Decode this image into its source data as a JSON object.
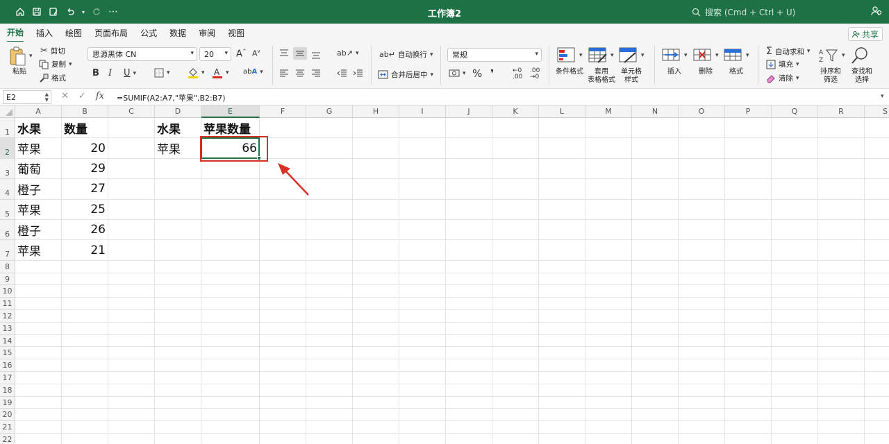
{
  "window": {
    "title": "工作簿2",
    "search_placeholder": "搜索 (Cmd + Ctrl + U)"
  },
  "tabs": [
    "开始",
    "插入",
    "绘图",
    "页面布局",
    "公式",
    "数据",
    "审阅",
    "视图"
  ],
  "share_label": "共享",
  "ribbon": {
    "paste": "粘贴",
    "cut": "剪切",
    "copy": "复制",
    "format_painter": "格式",
    "font_name": "思源黑体 CN",
    "font_size": "20",
    "wrap_text": "自动换行",
    "merge_center": "合并后居中",
    "number_format": "常规",
    "conditional_format": "条件格式",
    "table_format_l1": "套用",
    "table_format_l2": "表格格式",
    "cell_style_l1": "单元格",
    "cell_style_l2": "样式",
    "insert": "插入",
    "delete": "删除",
    "format": "格式",
    "autosum": "自动求和",
    "fill": "填充",
    "clear": "清除",
    "sort_filter_l1": "排序和",
    "sort_filter_l2": "筛选",
    "find_select_l1": "查找和",
    "find_select_l2": "选择"
  },
  "formula_bar": {
    "name_box": "E2",
    "formula": "=SUMIF(A2:A7,\"苹果\",B2:B7)"
  },
  "columns": [
    "A",
    "B",
    "C",
    "D",
    "E",
    "F",
    "G",
    "H",
    "I",
    "J",
    "K",
    "L",
    "M",
    "N",
    "O",
    "P",
    "Q",
    "R",
    "S"
  ],
  "rows": [
    "1",
    "2",
    "3",
    "4",
    "5",
    "6",
    "7",
    "8",
    "9",
    "10",
    "11",
    "12",
    "13",
    "14",
    "15",
    "16",
    "17",
    "18",
    "19",
    "20",
    "21",
    "22"
  ],
  "cells": {
    "A1": "水果",
    "B1": "数量",
    "D1": "水果",
    "E1": "苹果数量",
    "A2": "苹果",
    "B2": "20",
    "D2": "苹果",
    "E2": "66",
    "A3": "葡萄",
    "B3": "29",
    "A4": "橙子",
    "B4": "27",
    "A5": "苹果",
    "B5": "25",
    "A6": "橙子",
    "B6": "26",
    "A7": "苹果",
    "B7": "21"
  },
  "selected_cell": "E2",
  "accent_color": "#1e7145",
  "annotation_color": "#d93025"
}
